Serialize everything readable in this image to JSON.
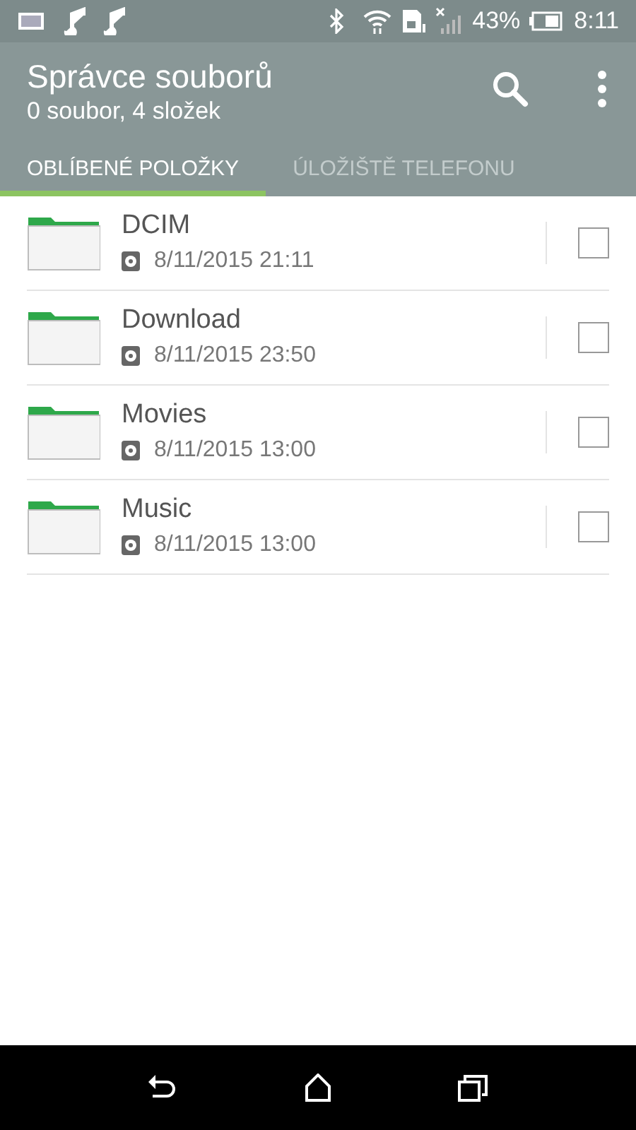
{
  "status_bar": {
    "battery": "43%",
    "time": "8:11"
  },
  "app_bar": {
    "title": "Správce souborů",
    "subtitle": "0 soubor, 4 složek"
  },
  "tabs": [
    {
      "label": "OBLÍBENÉ POLOŽKY",
      "selected": true
    },
    {
      "label": "ÚLOŽIŠTĚ TELEFONU",
      "selected": false
    }
  ],
  "folders": [
    {
      "name": "DCIM",
      "date": "8/11/2015 21:11",
      "checked": false
    },
    {
      "name": "Download",
      "date": "8/11/2015 23:50",
      "checked": false
    },
    {
      "name": "Movies",
      "date": "8/11/2015 13:00",
      "checked": false
    },
    {
      "name": "Music",
      "date": "8/11/2015 13:00",
      "checked": false
    }
  ]
}
